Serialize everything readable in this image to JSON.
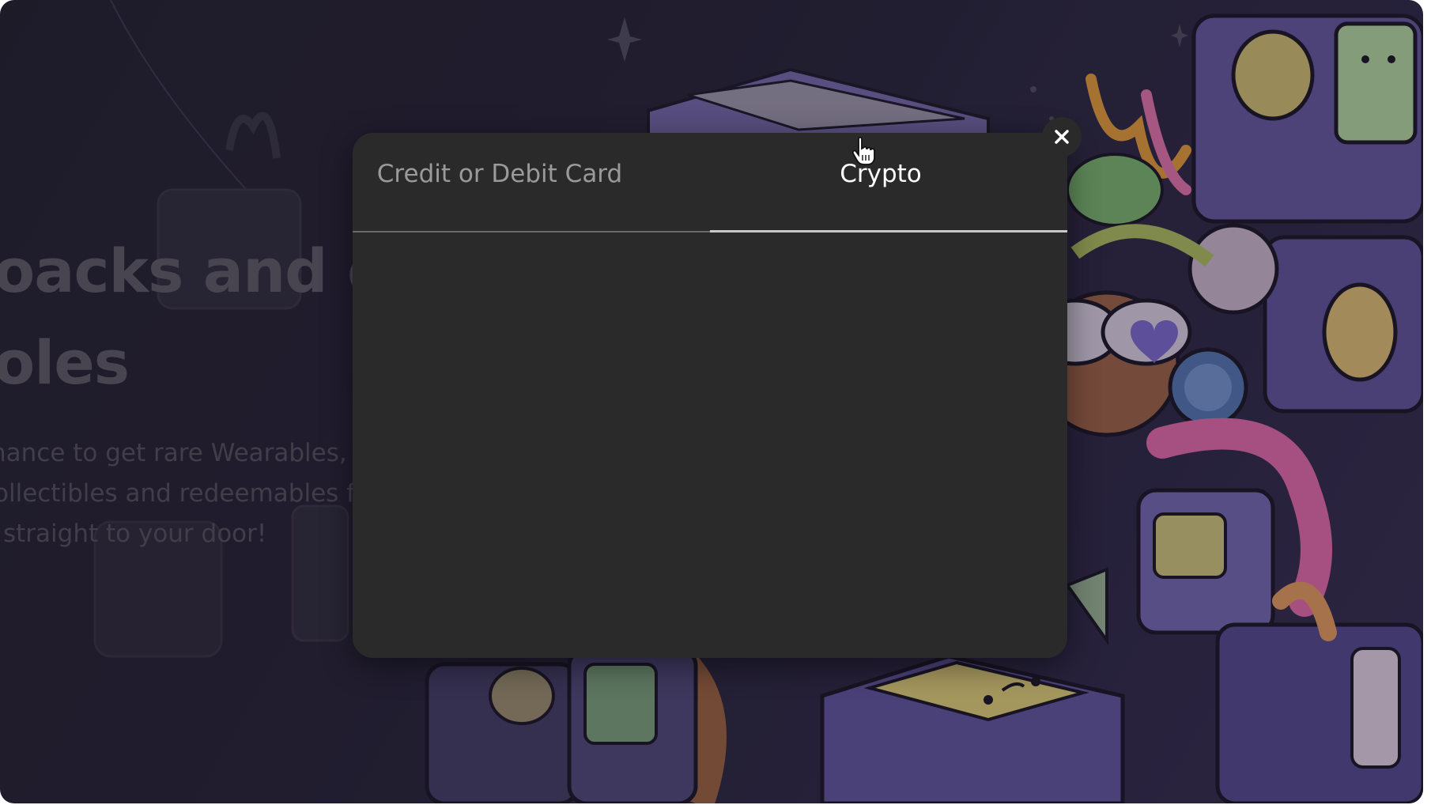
{
  "background": {
    "hero_title_lines": [
      "oacks and ge",
      "oles"
    ],
    "hero_text_lines": [
      "hance to get rare Wearables, e",
      "ollectibles and redeemables fo",
      "straight to your door!"
    ]
  },
  "modal": {
    "tabs": [
      {
        "label": "Credit or Debit Card",
        "active": false
      },
      {
        "label": "Crypto",
        "active": true
      }
    ],
    "close_icon": "close-icon"
  },
  "colors": {
    "modal_bg": "#2a2a2a",
    "active_tab_text": "#ffffff",
    "inactive_tab_text": "#9a9a9a"
  }
}
